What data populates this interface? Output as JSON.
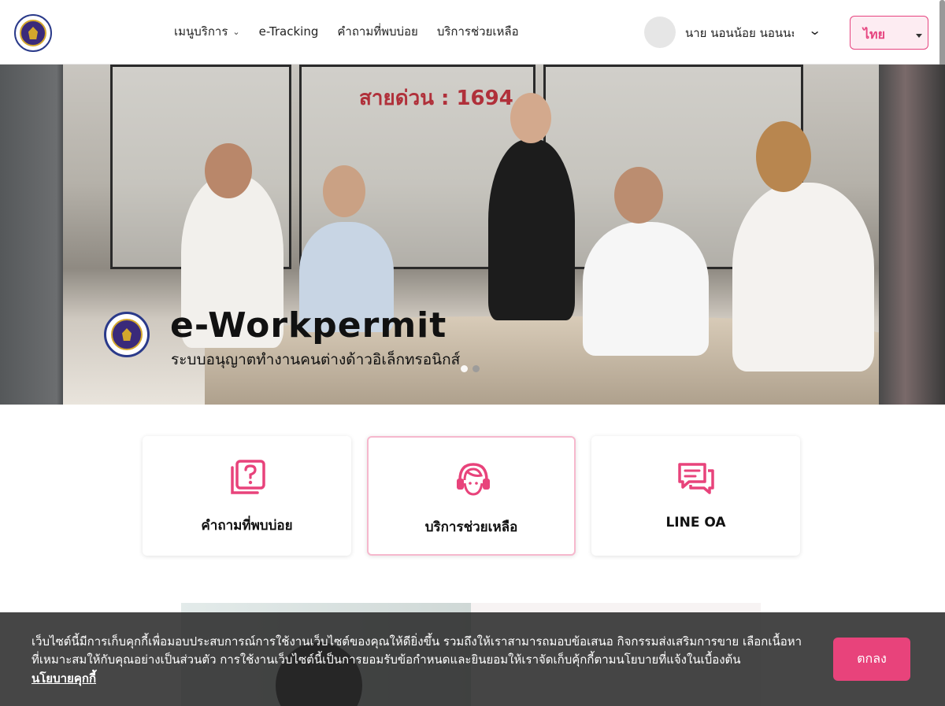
{
  "header": {
    "nav": [
      {
        "label": "เมนูบริการ",
        "has_dropdown": true
      },
      {
        "label": "e-Tracking"
      },
      {
        "label": "คำถามที่พบบ่อย"
      },
      {
        "label": "บริการช่วยเหลือ"
      }
    ],
    "user_name": "นาย นอนน้อย นอนนะ",
    "language": "ไทย"
  },
  "hero": {
    "title": "e-Workpermit",
    "subtitle": "ระบบอนุญาตทำงานคนต่างด้าวอิเล็กทรอนิกส์",
    "slides_total": 2,
    "active_slide": 1
  },
  "cards": [
    {
      "label": "คำถามที่พบบ่อย",
      "icon": "question-icon",
      "active": false
    },
    {
      "label": "บริการช่วยเหลือ",
      "icon": "headset-icon",
      "active": true
    },
    {
      "label": "LINE OA",
      "icon": "chat-icon",
      "active": false
    }
  ],
  "teaser": {
    "hotline": "สายด่วน : 1694"
  },
  "cookie": {
    "message": "เว็บไซต์นี้มีการเก็บคุกกี้เพื่อมอบประสบการณ์การใช้งานเว็บไซต์ของคุณให้ดียิ่งขึ้น รวมถึงให้เราสามารถมอบข้อเสนอ กิจกรรมส่งเสริมการขาย เลือกเนื้อหาที่เหมาะสมให้กับคุณอย่างเป็นส่วนตัว การใช้งานเว็บไซต์นี้เป็นการยอมรับข้อกำหนดและยินยอมให้เราจัดเก็บคุ้กกี้ตามนโยบายที่แจ้งในเบื้องต้น",
    "policy_link": "นโยบายคุกกี้",
    "accept_label": "ตกลง"
  },
  "colors": {
    "accent": "#e8437b",
    "accent_light": "#fdecf2",
    "card_active_border": "#f6b8cd"
  }
}
